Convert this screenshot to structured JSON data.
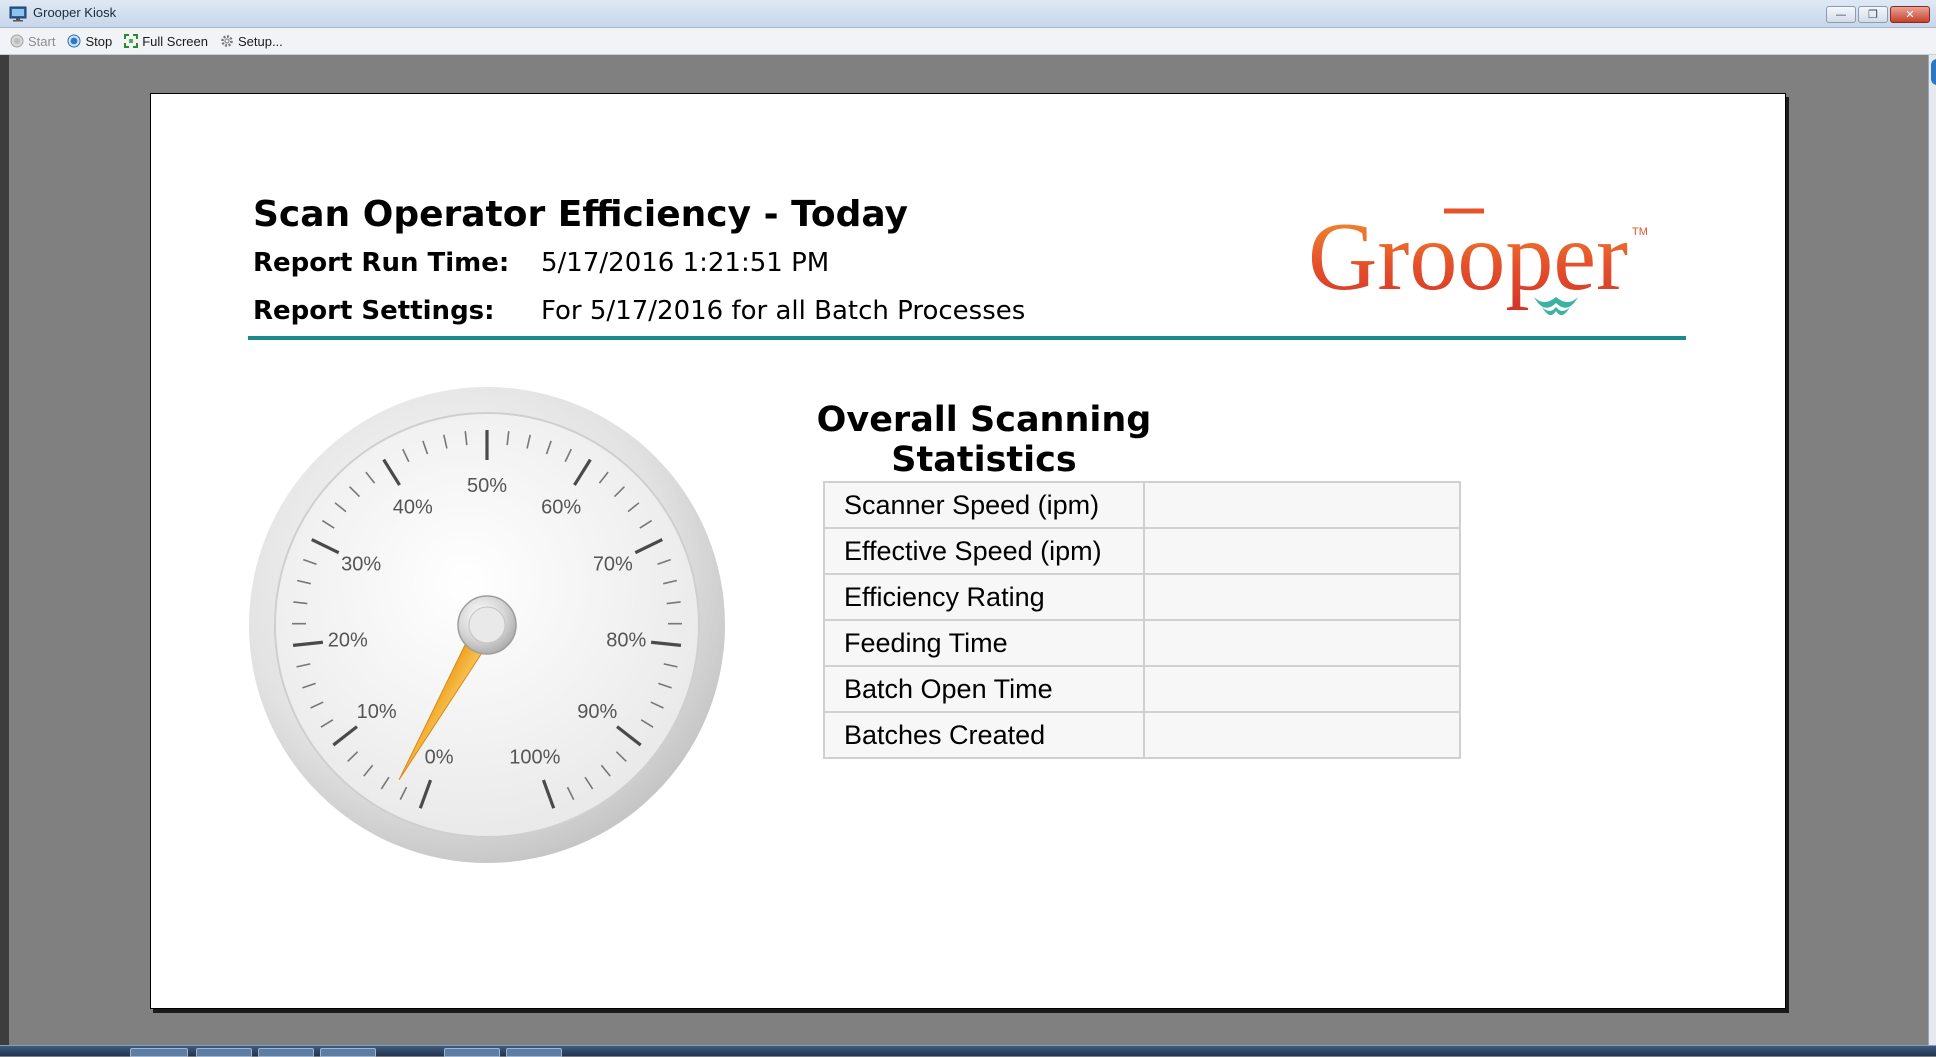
{
  "window": {
    "title": "Grooper Kiosk",
    "controls": [
      "minimize",
      "restore",
      "close"
    ]
  },
  "toolbar": {
    "start_label": "Start",
    "stop_label": "Stop",
    "fullscreen_label": "Full Screen",
    "setup_label": "Setup..."
  },
  "report": {
    "title": "Scan Operator Efficiency - Today",
    "run_time_label": "Report Run Time:",
    "run_time_value": "5/17/2016 1:21:51 PM",
    "settings_label": "Report Settings:",
    "settings_value": "For 5/17/2016 for all Batch Processes",
    "logo_text": "Grooper",
    "logo_tm": "TM",
    "accent_color": "#1b8a8c"
  },
  "gauge": {
    "value_percent": 3,
    "tick_labels": [
      "0%",
      "10%",
      "20%",
      "30%",
      "40%",
      "50%",
      "60%",
      "70%",
      "80%",
      "90%",
      "100%"
    ],
    "needle_color": "#f5b23a"
  },
  "statistics": {
    "title": "Overall Scanning Statistics",
    "rows": [
      {
        "label": "Scanner Speed (ipm)",
        "value": ""
      },
      {
        "label": "Effective Speed (ipm)",
        "value": ""
      },
      {
        "label": "Efficiency Rating",
        "value": ""
      },
      {
        "label": "Feeding Time",
        "value": ""
      },
      {
        "label": "Batch Open Time",
        "value": ""
      },
      {
        "label": "Batches Created",
        "value": ""
      }
    ]
  }
}
